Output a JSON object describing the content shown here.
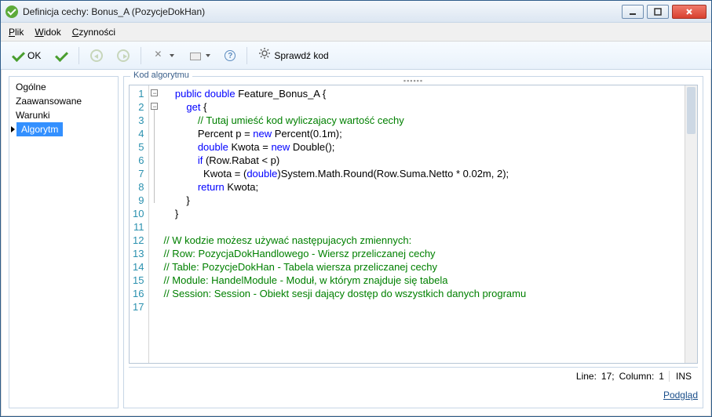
{
  "window": {
    "title": "Definicja cechy: Bonus_A (PozycjeDokHan)"
  },
  "menubar": {
    "file": "Plik",
    "view": "Widok",
    "actions": "Czynności"
  },
  "toolbar": {
    "ok_label": "OK",
    "check_label": "Sprawdź kod"
  },
  "sidebar": {
    "items": [
      {
        "label": "Ogólne",
        "selected": false
      },
      {
        "label": "Zaawansowane",
        "selected": false
      },
      {
        "label": "Warunki",
        "selected": false
      },
      {
        "label": "Algorytm",
        "selected": true
      }
    ]
  },
  "group": {
    "label": "Kod algorytmu"
  },
  "editor": {
    "line_count": 17,
    "tokens": [
      [
        [
          "sp",
          "    "
        ],
        [
          "kw",
          "public"
        ],
        [
          "sp",
          " "
        ],
        [
          "kw",
          "double"
        ],
        [
          "sp",
          " "
        ],
        [
          "pl",
          "Feature_Bonus_A {"
        ]
      ],
      [
        [
          "sp",
          "        "
        ],
        [
          "kw",
          "get"
        ],
        [
          "sp",
          " "
        ],
        [
          "pl",
          "{"
        ]
      ],
      [
        [
          "sp",
          "            "
        ],
        [
          "cm",
          "// Tutaj umieść kod wyliczajacy wartość cechy"
        ]
      ],
      [
        [
          "sp",
          "            "
        ],
        [
          "pl",
          "Percent p = "
        ],
        [
          "kw",
          "new"
        ],
        [
          "sp",
          " "
        ],
        [
          "pl",
          "Percent(0.1m);"
        ]
      ],
      [
        [
          "sp",
          "            "
        ],
        [
          "kw",
          "double"
        ],
        [
          "sp",
          " "
        ],
        [
          "pl",
          "Kwota = "
        ],
        [
          "kw",
          "new"
        ],
        [
          "sp",
          " "
        ],
        [
          "pl",
          "Double();"
        ]
      ],
      [
        [
          "sp",
          "            "
        ],
        [
          "kw",
          "if"
        ],
        [
          "sp",
          " "
        ],
        [
          "pl",
          "(Row.Rabat < p)"
        ]
      ],
      [
        [
          "sp",
          "              "
        ],
        [
          "pl",
          "Kwota = ("
        ],
        [
          "kw",
          "double"
        ],
        [
          "pl",
          ")System.Math.Round(Row.Suma.Netto * 0.02m, 2);"
        ]
      ],
      [
        [
          "sp",
          "            "
        ],
        [
          "kw",
          "return"
        ],
        [
          "sp",
          " "
        ],
        [
          "pl",
          "Kwota;"
        ]
      ],
      [
        [
          "sp",
          "        "
        ],
        [
          "pl",
          "}"
        ]
      ],
      [
        [
          "sp",
          "    "
        ],
        [
          "pl",
          "}"
        ]
      ],
      [],
      [
        [
          "cm",
          "// W kodzie możesz używać następujacych zmiennych:"
        ]
      ],
      [
        [
          "cm",
          "// Row: PozycjaDokHandlowego - Wiersz przeliczanej cechy"
        ]
      ],
      [
        [
          "cm",
          "// Table: PozycjeDokHan - Tabela wiersza przeliczanej cechy"
        ]
      ],
      [
        [
          "cm",
          "// Module: HandelModule - Moduł, w którym znajduje się tabela"
        ]
      ],
      [
        [
          "cm",
          "// Session: Session - Obiekt sesji dający dostęp do wszystkich danych programu"
        ]
      ],
      []
    ]
  },
  "status": {
    "line_label": "Line:",
    "line": "17;",
    "col_label": "Column:",
    "col": "1",
    "mode": "INS"
  },
  "footer": {
    "preview": "Podgląd"
  }
}
